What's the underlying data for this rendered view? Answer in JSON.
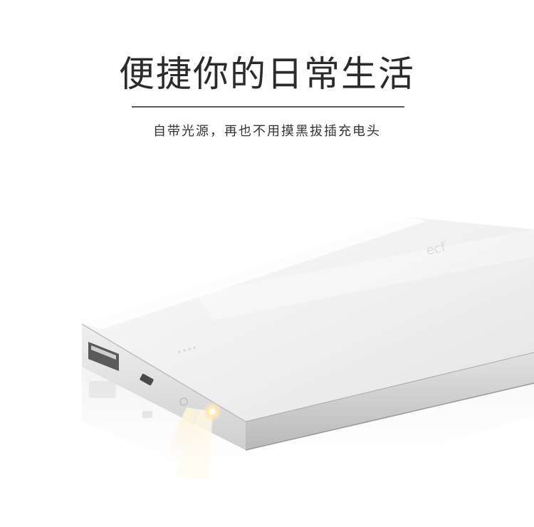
{
  "headline": "便捷你的日常生活",
  "subheadline": "自带光源，再也不用摸黑拔插充电头",
  "colors": {
    "background": "#ffffff",
    "text": "#2b2b2b",
    "divider": "#5a5a5a",
    "device_body": "#f2f2f2",
    "device_edge": "#c9c9c9",
    "light_beam": "#fff8e8"
  }
}
